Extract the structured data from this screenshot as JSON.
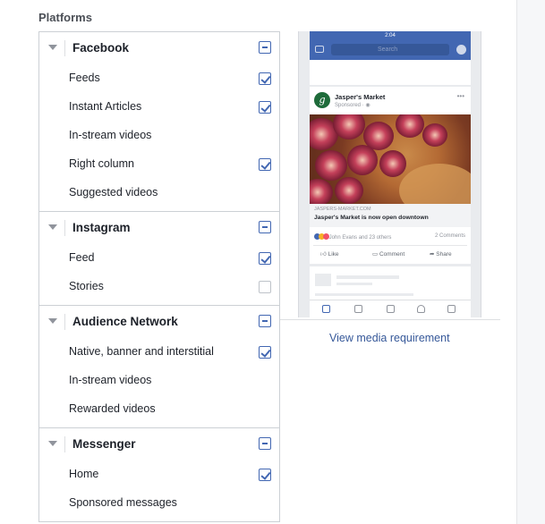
{
  "section_title": "Platforms",
  "groups": [
    {
      "name": "Facebook",
      "items": [
        {
          "label": "Feeds",
          "checked": true
        },
        {
          "label": "Instant Articles",
          "checked": true
        },
        {
          "label": "In-stream videos",
          "checked": null
        },
        {
          "label": "Right column",
          "checked": true
        },
        {
          "label": "Suggested videos",
          "checked": null
        }
      ]
    },
    {
      "name": "Instagram",
      "items": [
        {
          "label": "Feed",
          "checked": true
        },
        {
          "label": "Stories",
          "checked": false
        }
      ]
    },
    {
      "name": "Audience Network",
      "items": [
        {
          "label": "Native, banner and interstitial",
          "checked": true
        },
        {
          "label": "In-stream videos",
          "checked": null
        },
        {
          "label": "Rewarded videos",
          "checked": null
        }
      ]
    },
    {
      "name": "Messenger",
      "items": [
        {
          "label": "Home",
          "checked": true
        },
        {
          "label": "Sponsored messages",
          "checked": null
        }
      ]
    }
  ],
  "preview": {
    "status_time": "2:04",
    "search_placeholder": "Search",
    "page_name": "Jasper's Market",
    "sponsored": "Sponsored · ",
    "avatar_letter": "g",
    "link_domain": "JASPERS-MARKET.COM",
    "link_title": "Jasper's Market is now open downtown",
    "reactions_text": "John Evans and 23 others",
    "comments_count": "2 Comments",
    "like_label": "Like",
    "comment_label": "Comment",
    "share_label": "Share"
  },
  "view_media_link": "View media requirement",
  "colors": {
    "accent": "#4267b2",
    "border": "#ccd0d5",
    "link": "#365899"
  }
}
